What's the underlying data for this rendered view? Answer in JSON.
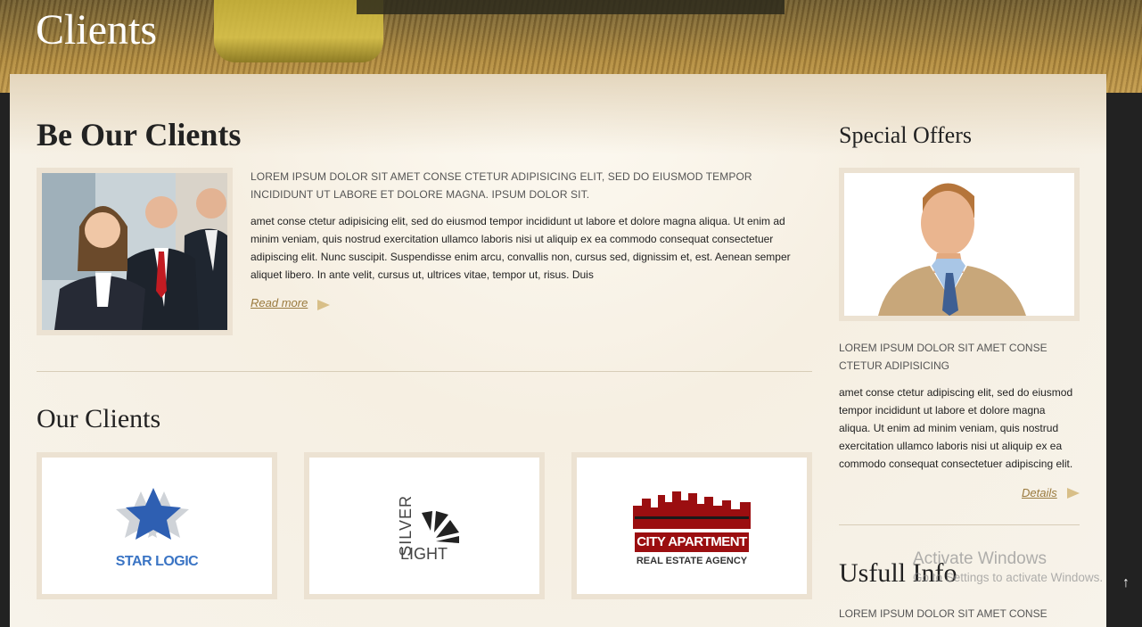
{
  "header": {
    "title": "Clients"
  },
  "main": {
    "section_title": "Be Our Clients",
    "lead_upper": "LOREM IPSUM DOLOR SIT AMET CONSE CTETUR ADIPISICING ELIT, SED DO EIUSMOD TEMPOR INCIDIDUNT UT LABORE ET DOLORE MAGNA. IPSUM DOLOR SIT.",
    "lead_body": "amet conse ctetur adipisicing elit, sed do eiusmod tempor incididunt ut labore et dolore magna aliqua. Ut enim ad minim veniam, quis nostrud exercitation ullamco laboris nisi ut aliquip ex ea commodo consequat consectetuer adipiscing elit. Nunc suscipit. Suspendisse enim arcu, convallis non, cursus sed, dignissim et, est. Aenean semper aliquet libero. In ante velit, cursus ut, ultrices vitae, tempor ut, risus. Duis",
    "read_more": "Read more",
    "clients_title": "Our Clients",
    "logos": {
      "star_logic": "STAR LOGIC",
      "silver": "SILVER",
      "light": "LIGHT",
      "city_apartment": "CITY APARTMENT",
      "city_sub": "REAL ESTATE AGENCY"
    }
  },
  "sidebar": {
    "offers_title": "Special Offers",
    "offer_upper": "LOREM IPSUM DOLOR SIT AMET CONSE CTETUR ADIPISICING",
    "offer_body": "amet conse ctetur adipiscing elit, sed do eiusmod tempor incididunt ut labore et dolore magna aliqua. Ut enim ad minim veniam, quis nostrud exercitation ullamco laboris nisi ut aliquip ex ea commodo consequat consectetuer adipiscing elit.",
    "details": "Details",
    "useful_title": "Usfull Info",
    "useful_upper": "LOREM IPSUM DOLOR SIT AMET CONSE"
  },
  "watermark": {
    "line1": "Activate Windows",
    "line2": "Go to Settings to activate Windows."
  },
  "icons": {
    "arrow": "arrow-right-icon",
    "scroll": "arrow-up-icon"
  }
}
